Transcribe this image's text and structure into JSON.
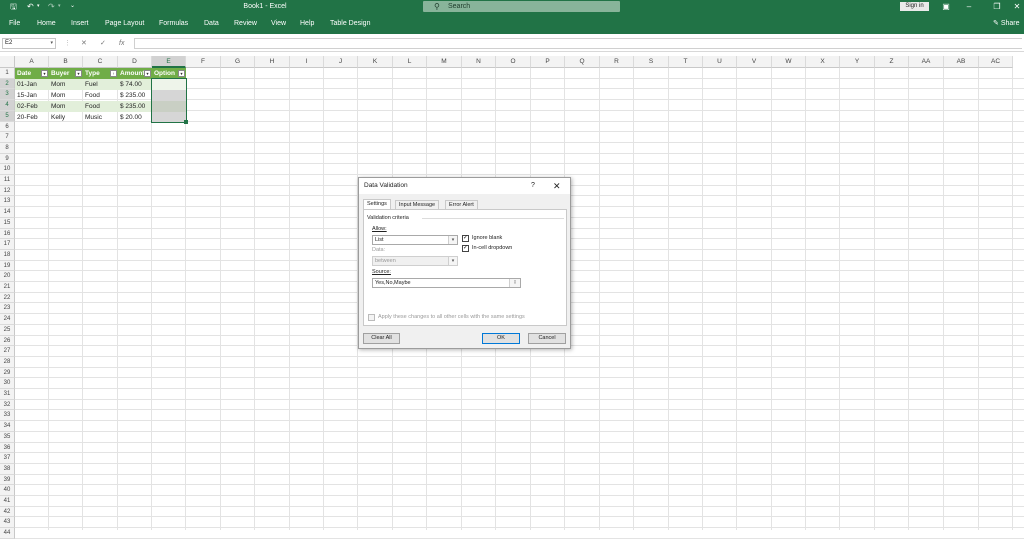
{
  "titlebar": {
    "doc_title": "Book1 - Excel",
    "search_placeholder": "Search",
    "signin": "Sign in",
    "qat": [
      "save-icon",
      "undo-icon",
      "redo-icon",
      "customize-icon"
    ]
  },
  "ribbon": {
    "tabs": [
      "File",
      "Home",
      "Insert",
      "Page Layout",
      "Formulas",
      "Data",
      "Review",
      "View",
      "Help",
      "Table Design"
    ],
    "share": "Share"
  },
  "formula_bar": {
    "name_box": "E2",
    "fx": "fx",
    "cancel": "✕",
    "enter": "✓",
    "value": ""
  },
  "sheet": {
    "columns": [
      "A",
      "B",
      "C",
      "D",
      "E",
      "F",
      "G",
      "H",
      "I",
      "J",
      "K",
      "L",
      "M",
      "N",
      "O",
      "P",
      "Q",
      "R",
      "S",
      "T",
      "U",
      "V",
      "W",
      "X",
      "Y",
      "Z",
      "AA",
      "AB",
      "AC"
    ],
    "rows": [
      "1",
      "2",
      "3",
      "4",
      "5",
      "6",
      "7",
      "8",
      "9",
      "10",
      "11",
      "12",
      "13",
      "14",
      "15",
      "16",
      "17",
      "18",
      "19",
      "20",
      "21",
      "22",
      "23",
      "24",
      "25",
      "26",
      "27",
      "28",
      "29",
      "30",
      "31",
      "32",
      "33",
      "34",
      "35",
      "36",
      "37",
      "38",
      "39",
      "40",
      "41",
      "42",
      "43",
      "44",
      "45",
      "46"
    ],
    "headers": [
      "Date",
      "Buyer",
      "Type",
      "Amount",
      "Option"
    ],
    "data": [
      {
        "date": "01-Jan",
        "buyer": "Mom",
        "type": "Fuel",
        "amount": "$   74.00"
      },
      {
        "date": "15-Jan",
        "buyer": "Mom",
        "type": "Food",
        "amount": "$ 235.00"
      },
      {
        "date": "02-Feb",
        "buyer": "Mom",
        "type": "Food",
        "amount": "$ 235.00"
      },
      {
        "date": "20-Feb",
        "buyer": "Kelly",
        "type": "Music",
        "amount": "$   20.00"
      }
    ],
    "colors": {
      "header_fill": "#70ad47",
      "band_fill": "#e2efda",
      "selection": "#217346"
    }
  },
  "dialog": {
    "title": "Data Validation",
    "help": "?",
    "close": "✕",
    "tabs": [
      "Settings",
      "Input Message",
      "Error Alert"
    ],
    "section": "Validation criteria",
    "allow_label": "Allow:",
    "allow_value": "List",
    "data_label": "Data:",
    "data_value": "between",
    "ignore_blank": "Ignore blank",
    "incell_dropdown": "In-cell dropdown",
    "source_label": "Source:",
    "source_value": "Yes,No,Maybe",
    "apply_all": "Apply these changes to all other cells with the same settings",
    "clear_all": "Clear All",
    "ok": "OK",
    "cancel": "Cancel"
  }
}
